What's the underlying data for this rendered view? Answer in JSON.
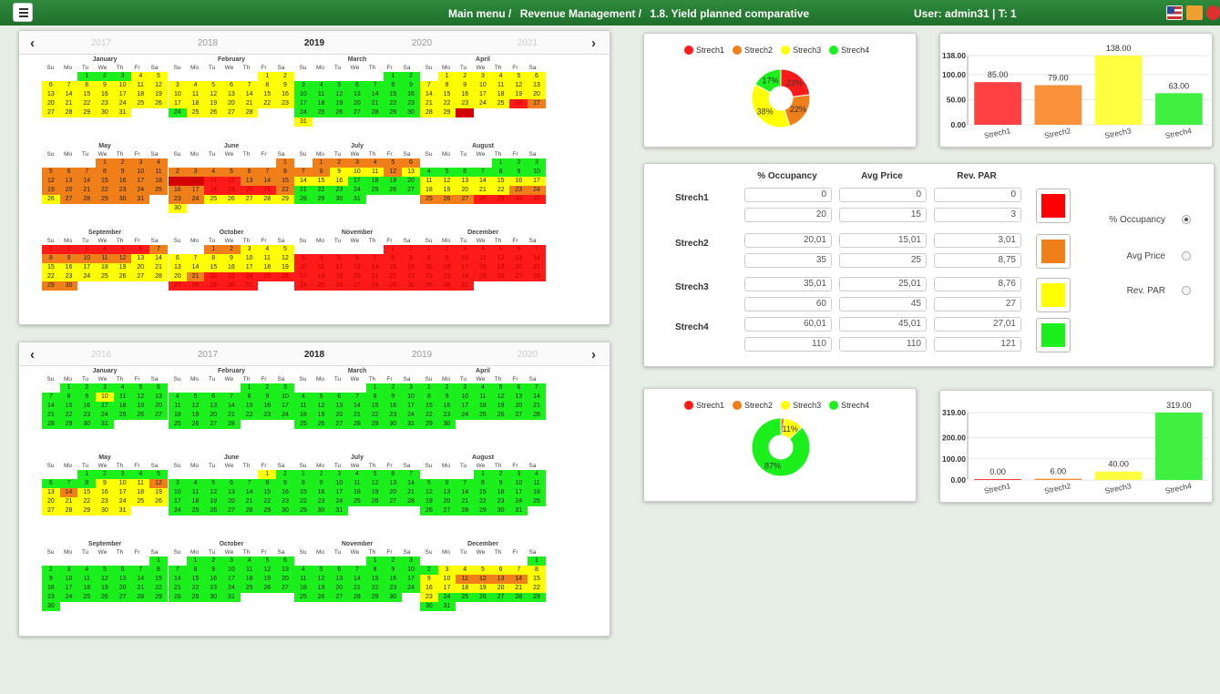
{
  "topbar": {
    "breadcrumb": [
      "Main menu /",
      "Revenue Management /",
      "1.8. Yield planned comparative"
    ],
    "user": "User: admin31 | T: 1"
  },
  "colors": {
    "red": "#ff1a1a",
    "orange": "#f07f1a",
    "yellow": "#ffff00",
    "green": "#1cf01c",
    "darkred": "#d60000",
    "darkorange": "#e26b0a",
    "brownred": "#c0392b"
  },
  "calendar_top": {
    "years": [
      "2017",
      "2018",
      "2019",
      "2020",
      "2021"
    ],
    "selected_year": "2019",
    "dow": [
      "Su",
      "Mo",
      "Tu",
      "We",
      "Th",
      "Fr",
      "Sa"
    ],
    "months": [
      {
        "name": "January",
        "start": 2,
        "days": 31,
        "colors": "GGGYYYYYYYYYYYYYYYYYYYYYYYYYYYY"
      },
      {
        "name": "February",
        "start": 5,
        "days": 28,
        "colors": "YYYYYYYYYYYYYYYYYYYYYYYGYYYY"
      },
      {
        "name": "March",
        "start": 5,
        "days": 31,
        "colors": "GGGGGGGGGGGGGGGGGGGGGGGGGGGGGGY"
      },
      {
        "name": "April",
        "start": 1,
        "days": 30,
        "colors": "YYYYYYYYYYYYYYYYYYYYYYYYYROYYDBB"
      },
      {
        "name": "May",
        "start": 3,
        "days": 31,
        "colors": "OOOOOOOOOOOOOOOOOOOOOOOOOYOOOOO"
      },
      {
        "name": "June",
        "start": 6,
        "days": 30,
        "colors": "OOOOOOOODDRROOOOORRRROOOYYYYYYY"
      },
      {
        "name": "July",
        "start": 1,
        "days": 31,
        "colors": "OOOOOOOOYYYOYYYYGGGGGGGGGGGGGGG"
      },
      {
        "name": "August",
        "start": 4,
        "days": 31,
        "colors": "GGGGGGGGGGYYYYYYYYYYYYOOOOORRRR"
      },
      {
        "name": "September",
        "start": 0,
        "days": 30,
        "colors": "RRRRRROOOOOOYYYYYYYYYYYYYYYYOO"
      },
      {
        "name": "October",
        "start": 2,
        "days": 31,
        "colors": "OOYYYYYYYYYYYYYYYYYYORRRRRRRRRR"
      },
      {
        "name": "November",
        "start": 5,
        "days": 30,
        "colors": "RRRRRRRRRRRRRRRRRRRRRRRRRRRRRR"
      },
      {
        "name": "December",
        "start": 0,
        "days": 31,
        "colors": "RRRRRRRRRRRRRRRRRRRRRRRRRRRRRRR"
      }
    ]
  },
  "calendar_bottom": {
    "years": [
      "2016",
      "2017",
      "2018",
      "2019",
      "2020"
    ],
    "selected_year": "2018",
    "dow": [
      "Su",
      "Mo",
      "Tu",
      "We",
      "Th",
      "Fr",
      "Sa"
    ],
    "months": [
      {
        "name": "January",
        "start": 1,
        "days": 31,
        "colors": "GGGGGGGGGYGGGGGGGGGGGGGGGGGGGGG"
      },
      {
        "name": "February",
        "start": 4,
        "days": 28,
        "colors": "GGGGGGGGGGGGGGGGGGGGGGGGGGGG"
      },
      {
        "name": "March",
        "start": 4,
        "days": 31,
        "colors": "GGGGGGGGGGGGGGGGGGGGGGGGGGGGGGG"
      },
      {
        "name": "April",
        "start": 0,
        "days": 30,
        "colors": "GGGGGGGGGGGGGGGGGGGGGGGGGGGGGG"
      },
      {
        "name": "May",
        "start": 2,
        "days": 31,
        "colors": "GGGGGGGGYYYOYOYYYYYYYYYYYYYYYYY"
      },
      {
        "name": "June",
        "start": 5,
        "days": 30,
        "colors": "YGGGGGGGGGGGGGGGGGGGGGGGGGGGGG"
      },
      {
        "name": "July",
        "start": 0,
        "days": 31,
        "colors": "GGGGGGGGGGGGGGGGGGGGGGGGGGGGGGG"
      },
      {
        "name": "August",
        "start": 3,
        "days": 31,
        "colors": "GGGGGGGGGGGGGGGGGGGGGGGGGGGGGGG"
      },
      {
        "name": "September",
        "start": 6,
        "days": 30,
        "colors": "GGGGGGGGGGGGGGGGGGGGGGGGGGGGGG"
      },
      {
        "name": "October",
        "start": 1,
        "days": 31,
        "colors": "GGGGGGGGGGGGGGGGGGGGGGGGGGGGGGG"
      },
      {
        "name": "November",
        "start": 4,
        "days": 30,
        "colors": "GGGGGGGGGGGGGGGGGGGGGGGGGGGGGG"
      },
      {
        "name": "December",
        "start": 6,
        "days": 31,
        "colors": "GGYYYYYYYYOOOOYYYYYYYYYGGGGGGGG"
      }
    ]
  },
  "legend": [
    "Strech1",
    "Strech2",
    "Strech3",
    "Strech4"
  ],
  "table": {
    "headers": [
      "% Occupancy",
      "Avg Price",
      "Rev. PAR"
    ],
    "rows": [
      {
        "label": "Strech1",
        "from": [
          "0",
          "0",
          "0"
        ],
        "to": [
          "20",
          "15",
          "3"
        ],
        "color": "#ff0000"
      },
      {
        "label": "Strech2",
        "from": [
          "20,01",
          "15,01",
          "3,01"
        ],
        "to": [
          "35",
          "25",
          "8,75"
        ],
        "color": "#f07f1a"
      },
      {
        "label": "Strech3",
        "from": [
          "35,01",
          "25,01",
          "8,76"
        ],
        "to": [
          "60",
          "45",
          "27"
        ],
        "color": "#ffff00"
      },
      {
        "label": "Strech4",
        "from": [
          "60,01",
          "45,01",
          "27,01"
        ],
        "to": [
          "110",
          "110",
          "121"
        ],
        "color": "#1cf01c"
      }
    ],
    "radios": [
      {
        "label": "% Occupancy",
        "checked": true
      },
      {
        "label": "Avg Price",
        "checked": false
      },
      {
        "label": "Rev. PAR",
        "checked": false
      }
    ]
  },
  "chart_data": [
    {
      "type": "pie",
      "labels": [
        "Strech1",
        "Strech2",
        "Strech3",
        "Strech4"
      ],
      "values": [
        23,
        22,
        38,
        17
      ],
      "slice_labels": [
        "23%",
        "22%",
        "38%",
        "17%"
      ],
      "colors": [
        "#ff1a1a",
        "#f07f1a",
        "#ffff00",
        "#1cf01c"
      ]
    },
    {
      "type": "bar",
      "categories": [
        "Strech1",
        "Strech2",
        "Strech3",
        "Strech4"
      ],
      "values": [
        85,
        79,
        138,
        63
      ],
      "value_labels": [
        "85.00",
        "79.00",
        "138.00",
        "63.00"
      ],
      "tick_labels": [
        "0.00",
        "50.00",
        "100.00",
        "138.00"
      ],
      "ylim": [
        0,
        138
      ],
      "colors": [
        "#ff4040",
        "#f7923a",
        "#ffff40",
        "#40f040"
      ]
    },
    {
      "type": "pie",
      "labels": [
        "Strech1",
        "Strech2",
        "Strech3",
        "Strech4"
      ],
      "values": [
        0,
        2,
        11,
        87
      ],
      "slice_labels": [
        "",
        "",
        "11%",
        "87%"
      ],
      "colors": [
        "#ff1a1a",
        "#f07f1a",
        "#ffff00",
        "#1cf01c"
      ]
    },
    {
      "type": "bar",
      "categories": [
        "Strech1",
        "Strech2",
        "Strech3",
        "Strech4"
      ],
      "values": [
        0,
        6,
        40,
        319
      ],
      "value_labels": [
        "0.00",
        "6.00",
        "40.00",
        "319.00"
      ],
      "tick_labels": [
        "0.00",
        "100.00",
        "200.00",
        "319.00"
      ],
      "ylim": [
        0,
        319
      ],
      "colors": [
        "#ff4040",
        "#f7923a",
        "#ffff40",
        "#40f040"
      ]
    }
  ]
}
